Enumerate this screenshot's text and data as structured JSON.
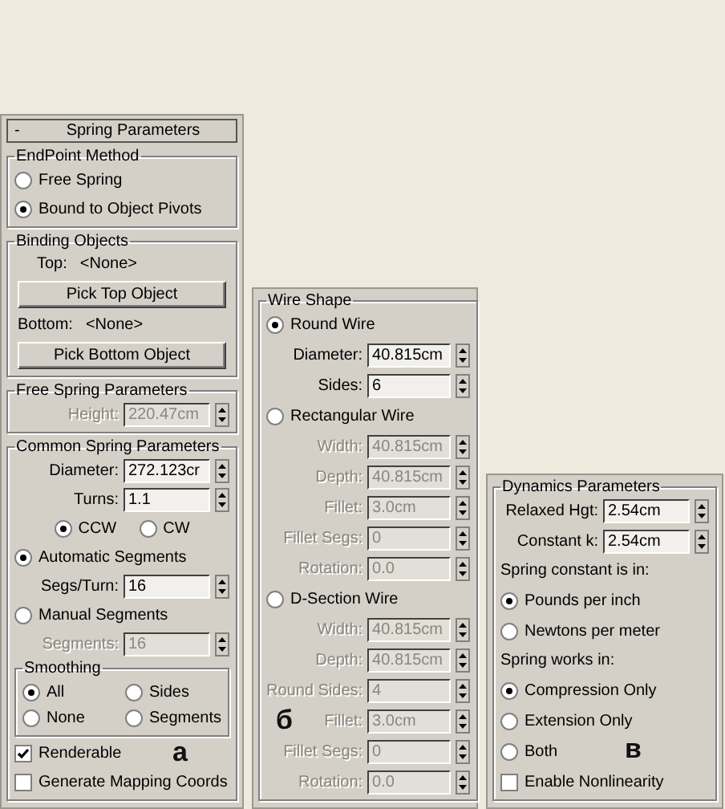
{
  "panels": [
    {
      "figure_label": "а",
      "rollout": {
        "sign": "-",
        "title": "Spring Parameters"
      },
      "groups": [
        {
          "title": "EndPoint Method",
          "rows": [
            {
              "kind": "radio",
              "label": "Free Spring",
              "selected": false
            },
            {
              "kind": "radio",
              "label": "Bound to Object Pivots",
              "selected": true
            }
          ]
        },
        {
          "title": "Binding Objects",
          "rows": [
            {
              "kind": "info",
              "label": "Top:",
              "value": "<None>"
            },
            {
              "kind": "button",
              "label": "Pick Top Object"
            },
            {
              "kind": "info",
              "label": "Bottom:",
              "value": "<None>"
            },
            {
              "kind": "button",
              "label": "Pick Bottom Object"
            }
          ]
        },
        {
          "title": "Free Spring Parameters",
          "rows": [
            {
              "kind": "field",
              "label": "Height:",
              "value": "220.47cm",
              "disabled": true
            }
          ]
        },
        {
          "title": "Common Spring Parameters",
          "rows": [
            {
              "kind": "field",
              "label": "Diameter:",
              "value": "272.123cr",
              "disabled": false
            },
            {
              "kind": "field",
              "label": "Turns:",
              "value": "1.1",
              "disabled": false
            },
            {
              "kind": "choices",
              "options": [
                {
                  "label": "CCW",
                  "selected": true
                },
                {
                  "label": "CW",
                  "selected": false
                }
              ]
            },
            {
              "kind": "radio",
              "label": "Automatic Segments",
              "selected": true
            },
            {
              "kind": "field",
              "label": "Segs/Turn:",
              "value": "16",
              "disabled": false
            },
            {
              "kind": "radio",
              "label": "Manual Segments",
              "selected": false
            },
            {
              "kind": "field",
              "label": "Segments:",
              "value": "16",
              "disabled": true
            },
            {
              "kind": "subgroup",
              "title": "Smoothing",
              "options": [
                {
                  "label": "All",
                  "selected": true
                },
                {
                  "label": "Sides",
                  "selected": false
                },
                {
                  "label": "None",
                  "selected": false
                },
                {
                  "label": "Segments",
                  "selected": false
                }
              ]
            },
            {
              "kind": "checkbox",
              "label": "Renderable",
              "checked": true
            },
            {
              "kind": "checkbox",
              "label": "Generate Mapping Coords",
              "checked": false
            }
          ]
        }
      ]
    },
    {
      "figure_label": "б",
      "groups": [
        {
          "title": "Wire Shape",
          "rows": [
            {
              "kind": "radio",
              "label": "Round Wire",
              "selected": true
            },
            {
              "kind": "field",
              "label": "Diameter:",
              "value": "40.815cm",
              "disabled": false
            },
            {
              "kind": "field",
              "label": "Sides:",
              "value": "6",
              "disabled": false
            },
            {
              "kind": "radio",
              "label": "Rectangular Wire",
              "selected": false
            },
            {
              "kind": "field",
              "label": "Width:",
              "value": "40.815cm",
              "disabled": true
            },
            {
              "kind": "field",
              "label": "Depth:",
              "value": "40.815cm",
              "disabled": true
            },
            {
              "kind": "field",
              "label": "Fillet:",
              "value": "3.0cm",
              "disabled": true
            },
            {
              "kind": "field",
              "label": "Fillet Segs:",
              "value": "0",
              "disabled": true
            },
            {
              "kind": "field",
              "label": "Rotation:",
              "value": "0.0",
              "disabled": true
            },
            {
              "kind": "radio",
              "label": "D-Section Wire",
              "selected": false
            },
            {
              "kind": "field",
              "label": "Width:",
              "value": "40.815cm",
              "disabled": true
            },
            {
              "kind": "field",
              "label": "Depth:",
              "value": "40.815cm",
              "disabled": true
            },
            {
              "kind": "field",
              "label": "Round Sides:",
              "value": "4",
              "disabled": true
            },
            {
              "kind": "field",
              "label": "Fillet:",
              "value": "3.0cm",
              "disabled": true
            },
            {
              "kind": "field",
              "label": "Fillet Segs:",
              "value": "0",
              "disabled": true
            },
            {
              "kind": "field",
              "label": "Rotation:",
              "value": "0.0",
              "disabled": true
            }
          ]
        }
      ]
    },
    {
      "figure_label": "в",
      "groups": [
        {
          "title": "Dynamics Parameters",
          "rows": [
            {
              "kind": "field",
              "label": "Relaxed Hgt:",
              "value": "2.54cm",
              "disabled": false
            },
            {
              "kind": "field",
              "label": "Constant k:",
              "value": "2.54cm",
              "disabled": false
            },
            {
              "kind": "text",
              "label": "Spring constant is in:"
            },
            {
              "kind": "radio",
              "label": "Pounds per inch",
              "selected": true
            },
            {
              "kind": "radio",
              "label": "Newtons per meter",
              "selected": false
            },
            {
              "kind": "text",
              "label": "Spring works in:"
            },
            {
              "kind": "radio",
              "label": "Compression Only",
              "selected": true
            },
            {
              "kind": "radio",
              "label": "Extension Only",
              "selected": false
            },
            {
              "kind": "radio",
              "label": "Both",
              "selected": false
            },
            {
              "kind": "checkbox",
              "label": "Enable Nonlinearity",
              "checked": false
            }
          ]
        }
      ]
    }
  ]
}
